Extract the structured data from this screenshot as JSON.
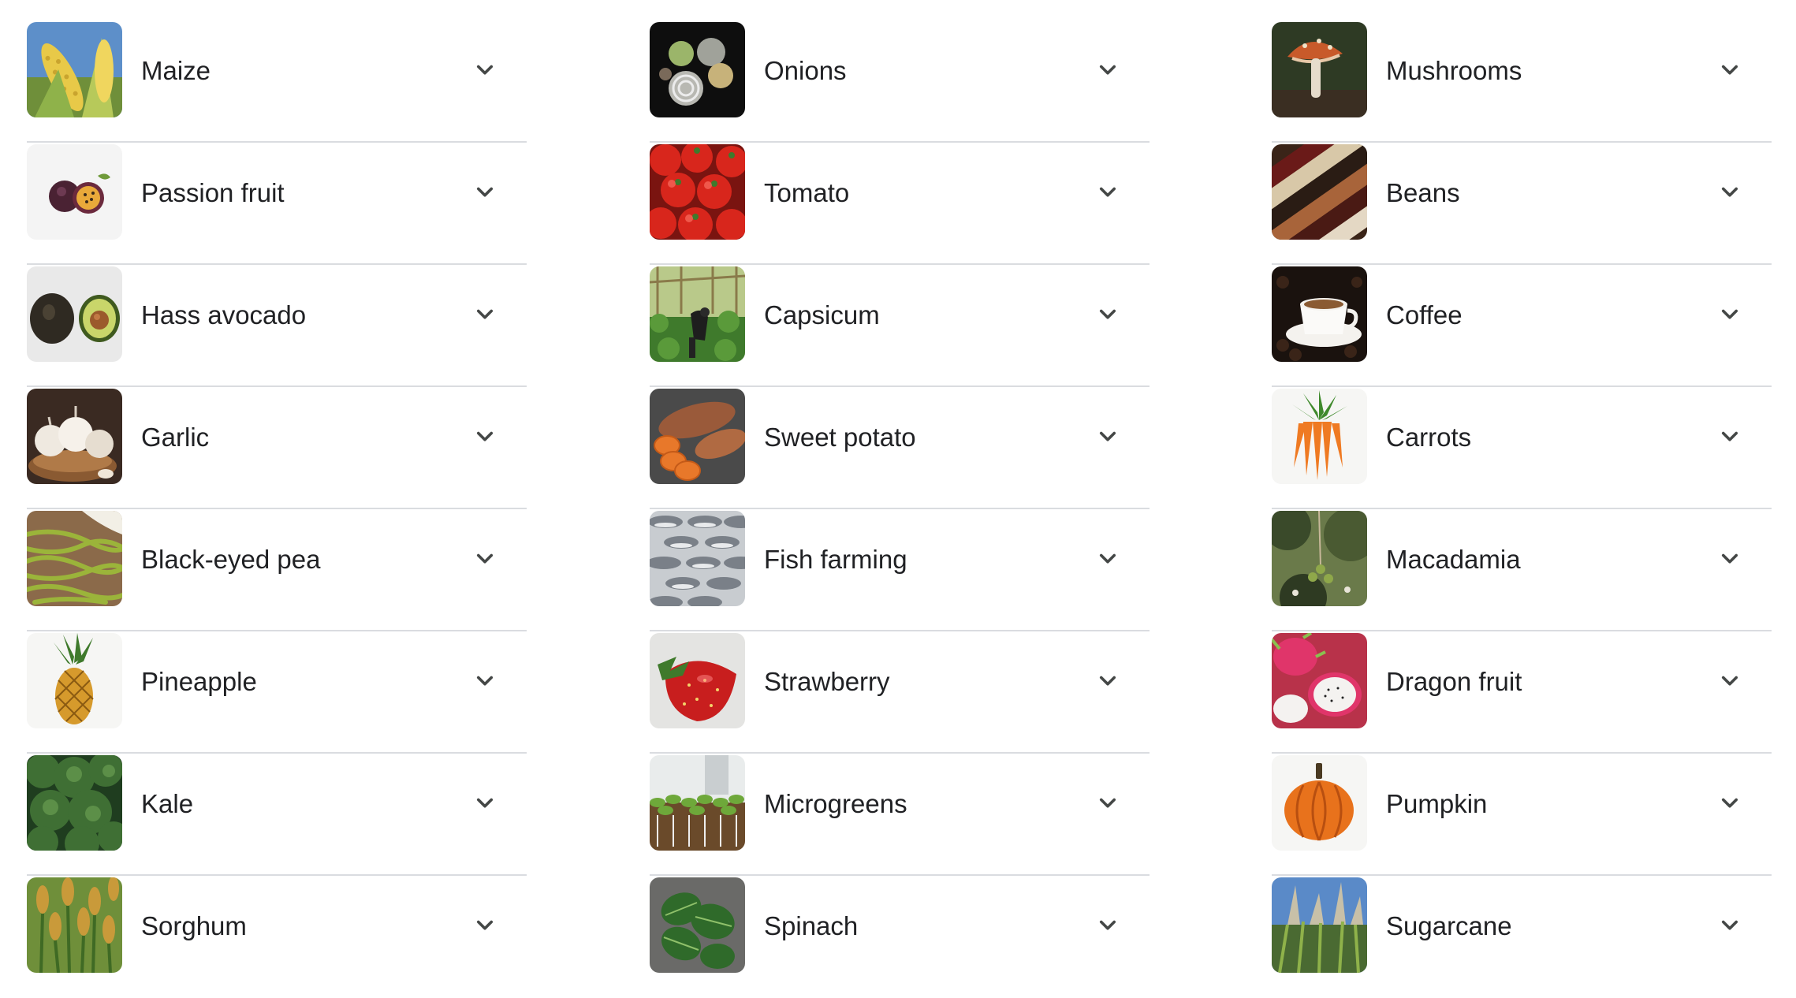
{
  "columns": [
    {
      "items": [
        {
          "label": "Maize",
          "image": "maize-cobs"
        },
        {
          "label": "Passion fruit",
          "image": "passion-fruit-halves"
        },
        {
          "label": "Hass avocado",
          "image": "hass-avocado-halves"
        },
        {
          "label": "Garlic",
          "image": "garlic-bulbs-in-bowl"
        },
        {
          "label": "Black-eyed pea",
          "image": "black-eyed-pea-pods"
        },
        {
          "label": "Pineapple",
          "image": "pineapple"
        },
        {
          "label": "Kale",
          "image": "kale-leaves"
        },
        {
          "label": "Sorghum",
          "image": "sorghum-field"
        }
      ]
    },
    {
      "items": [
        {
          "label": "Onions",
          "image": "onions-on-dark"
        },
        {
          "label": "Tomato",
          "image": "tomatoes-pile"
        },
        {
          "label": "Capsicum",
          "image": "capsicum-greenhouse"
        },
        {
          "label": "Sweet potato",
          "image": "sweet-potato-slices"
        },
        {
          "label": "Fish farming",
          "image": "fish-rows"
        },
        {
          "label": "Strawberry",
          "image": "strawberry"
        },
        {
          "label": "Microgreens",
          "image": "microgreens-tray"
        },
        {
          "label": "Spinach",
          "image": "spinach-leaves"
        }
      ]
    },
    {
      "items": [
        {
          "label": "Mushrooms",
          "image": "mushroom-in-soil"
        },
        {
          "label": "Beans",
          "image": "dried-beans-rows"
        },
        {
          "label": "Coffee",
          "image": "coffee-cup-and-beans"
        },
        {
          "label": "Carrots",
          "image": "carrots-bunch"
        },
        {
          "label": "Macadamia",
          "image": "macadamia-tree"
        },
        {
          "label": "Dragon fruit",
          "image": "dragon-fruit-halves"
        },
        {
          "label": "Pumpkin",
          "image": "pumpkin"
        },
        {
          "label": "Sugarcane",
          "image": "sugarcane-field"
        }
      ]
    }
  ],
  "icons": {
    "expand": "chevron-down-icon"
  },
  "colors": {
    "text": "#202124",
    "divider": "#dadce0",
    "chevron": "#444746"
  }
}
